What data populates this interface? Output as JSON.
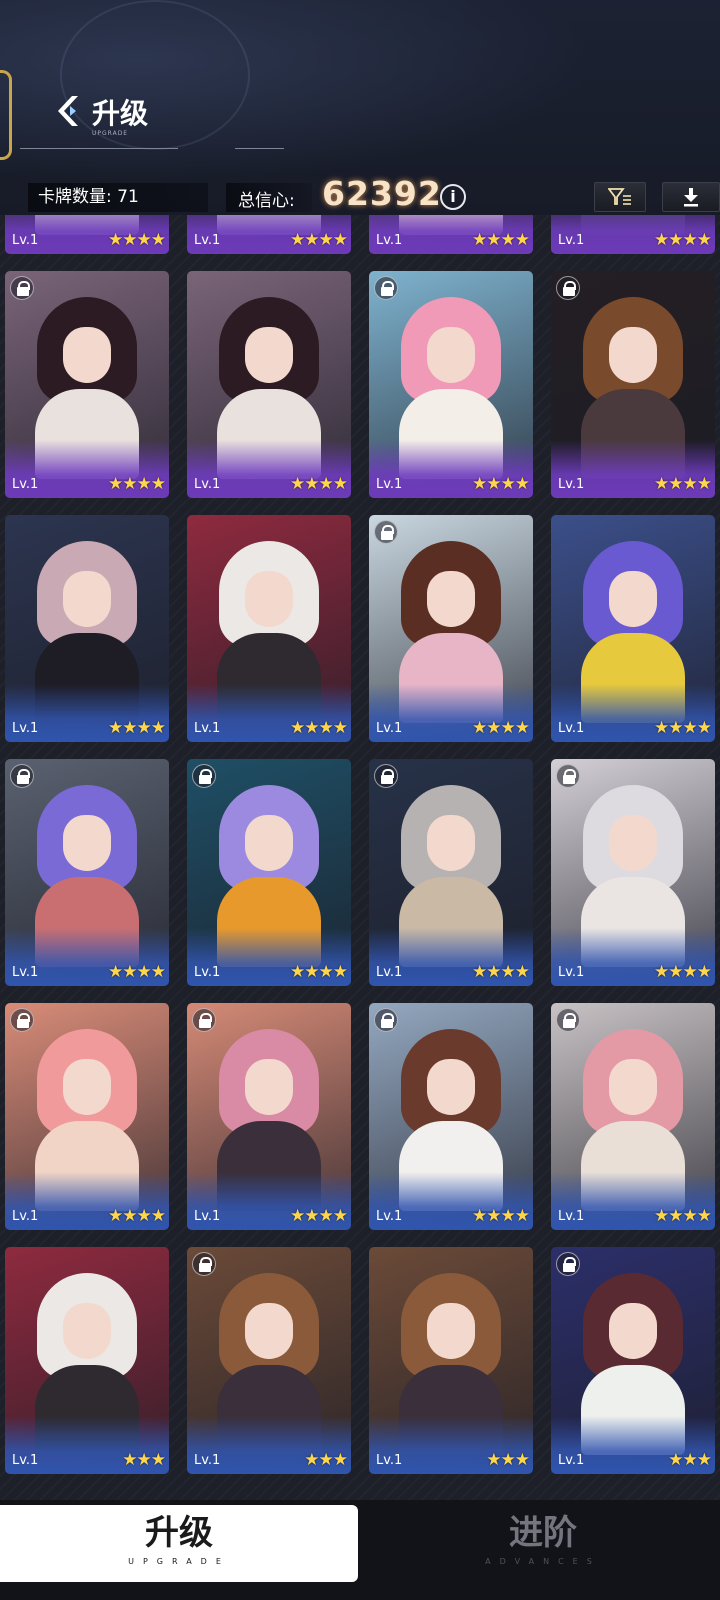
{
  "header": {
    "title": "升级",
    "subtitle": "UPGRADE",
    "card_count_label": "卡牌数量:",
    "card_count_value": "71",
    "trust_label": "总信心:",
    "trust_value": "62392"
  },
  "cards": [
    {
      "level": "Lv.1",
      "stars": "★★★★",
      "locked": false,
      "frame": "purple",
      "palette": {
        "bg": "#4b3a63",
        "hair": "#3a2229",
        "body": "#c8c3c6"
      }
    },
    {
      "level": "Lv.1",
      "stars": "★★★★",
      "locked": false,
      "frame": "purple",
      "palette": {
        "bg": "#4b3a63",
        "hair": "#3a2229",
        "body": "#c8c3c6"
      }
    },
    {
      "level": "Lv.1",
      "stars": "★★★★",
      "locked": false,
      "frame": "purple",
      "palette": {
        "bg": "#6c4f8c",
        "hair": "#e58ca8",
        "body": "#e7d7c8"
      }
    },
    {
      "level": "Lv.1",
      "stars": "★★★★",
      "locked": false,
      "frame": "purple",
      "palette": {
        "bg": "#2b2a36",
        "hair": "#6a3f2a",
        "body": "#3c3b52"
      }
    },
    {
      "level": "Lv.1",
      "stars": "★★★★",
      "locked": true,
      "frame": "purple",
      "palette": {
        "bg": "#7a6478",
        "hair": "#2c1b22",
        "body": "#e9e1dd"
      }
    },
    {
      "level": "Lv.1",
      "stars": "★★★★",
      "locked": false,
      "frame": "purple",
      "palette": {
        "bg": "#7a6478",
        "hair": "#2c1b22",
        "body": "#e9e1dd"
      }
    },
    {
      "level": "Lv.1",
      "stars": "★★★★",
      "locked": true,
      "frame": "purple",
      "palette": {
        "bg": "#7fb3cf",
        "hair": "#f19ab7",
        "body": "#f3efe8"
      }
    },
    {
      "level": "Lv.1",
      "stars": "★★★★",
      "locked": true,
      "frame": "purple",
      "palette": {
        "bg": "#241f24",
        "hair": "#7a4a2c",
        "body": "#4a3a3e"
      }
    },
    {
      "level": "Lv.1",
      "stars": "★★★★",
      "locked": false,
      "frame": "blue",
      "palette": {
        "bg": "#2c3550",
        "hair": "#c9a9b3",
        "body": "#1e1c24"
      }
    },
    {
      "level": "Lv.1",
      "stars": "★★★★",
      "locked": false,
      "frame": "blue",
      "palette": {
        "bg": "#8f2a3f",
        "hair": "#ebe8e6",
        "body": "#2e2a2f"
      }
    },
    {
      "level": "Lv.1",
      "stars": "★★★★",
      "locked": true,
      "frame": "blue",
      "palette": {
        "bg": "#c9d7e0",
        "hair": "#5a2e22",
        "body": "#e7b5c6"
      }
    },
    {
      "level": "Lv.1",
      "stars": "★★★★",
      "locked": false,
      "frame": "blue",
      "palette": {
        "bg": "#3b4f8a",
        "hair": "#6a5ad2",
        "body": "#e7c93d"
      }
    },
    {
      "level": "Lv.1",
      "stars": "★★★★",
      "locked": true,
      "frame": "blue",
      "palette": {
        "bg": "#5a6170",
        "hair": "#7a6ad6",
        "body": "#c96f72"
      }
    },
    {
      "level": "Lv.1",
      "stars": "★★★★",
      "locked": true,
      "frame": "blue",
      "palette": {
        "bg": "#1f4f66",
        "hair": "#9b8ae0",
        "body": "#e79a2b"
      }
    },
    {
      "level": "Lv.1",
      "stars": "★★★★",
      "locked": true,
      "frame": "blue",
      "palette": {
        "bg": "#273248",
        "hair": "#b6b2b1",
        "body": "#c9b9a5"
      }
    },
    {
      "level": "Lv.1",
      "stars": "★★★★",
      "locked": true,
      "frame": "blue",
      "palette": {
        "bg": "#d4cfd6",
        "hair": "#dedbe0",
        "body": "#eae5e2"
      }
    },
    {
      "level": "Lv.1",
      "stars": "★★★★",
      "locked": true,
      "frame": "blue",
      "palette": {
        "bg": "#d98c78",
        "hair": "#f19a9c",
        "body": "#f1d4c5"
      }
    },
    {
      "level": "Lv.1",
      "stars": "★★★★",
      "locked": true,
      "frame": "blue",
      "palette": {
        "bg": "#d58a76",
        "hair": "#d98aa4",
        "body": "#3a2f3a"
      }
    },
    {
      "level": "Lv.1",
      "stars": "★★★★",
      "locked": true,
      "frame": "blue",
      "palette": {
        "bg": "#94a8c0",
        "hair": "#6a3a2c",
        "body": "#f2f0ee"
      }
    },
    {
      "level": "Lv.1",
      "stars": "★★★★",
      "locked": true,
      "frame": "blue",
      "palette": {
        "bg": "#c8c2c4",
        "hair": "#e39aa5",
        "body": "#e9dfd6"
      }
    },
    {
      "level": "Lv.1",
      "stars": "★★★",
      "locked": false,
      "frame": "blue",
      "palette": {
        "bg": "#8f2a3f",
        "hair": "#ebe8e6",
        "body": "#2e2a2f"
      }
    },
    {
      "level": "Lv.1",
      "stars": "★★★",
      "locked": true,
      "frame": "blue",
      "palette": {
        "bg": "#6b4a38",
        "hair": "#8a5a3a",
        "body": "#3a2f3a"
      }
    },
    {
      "level": "Lv.1",
      "stars": "★★★",
      "locked": false,
      "frame": "blue",
      "palette": {
        "bg": "#6b4a38",
        "hair": "#8a5a3a",
        "body": "#3a2f3a"
      }
    },
    {
      "level": "Lv.1",
      "stars": "★★★",
      "locked": true,
      "frame": "blue",
      "palette": {
        "bg": "#2c2f6a",
        "hair": "#5a2a32",
        "body": "#eef0ee"
      }
    }
  ],
  "tabs": {
    "upgrade": {
      "label": "升级",
      "sub": "UPGRADE"
    },
    "advance": {
      "label": "进阶",
      "sub": "ADVANCES"
    }
  },
  "icons": {
    "title": "upgrade-chevron-icon",
    "info": "info-icon",
    "filter": "filter-icon",
    "download": "download-icon",
    "lock": "lock-icon"
  },
  "colors": {
    "accent_gold": "#c9a54c",
    "trust_value": "#f7e4c8",
    "star": "#ffd64a",
    "frame_purple": "#6d3ab8",
    "frame_blue": "#2f55ae"
  }
}
